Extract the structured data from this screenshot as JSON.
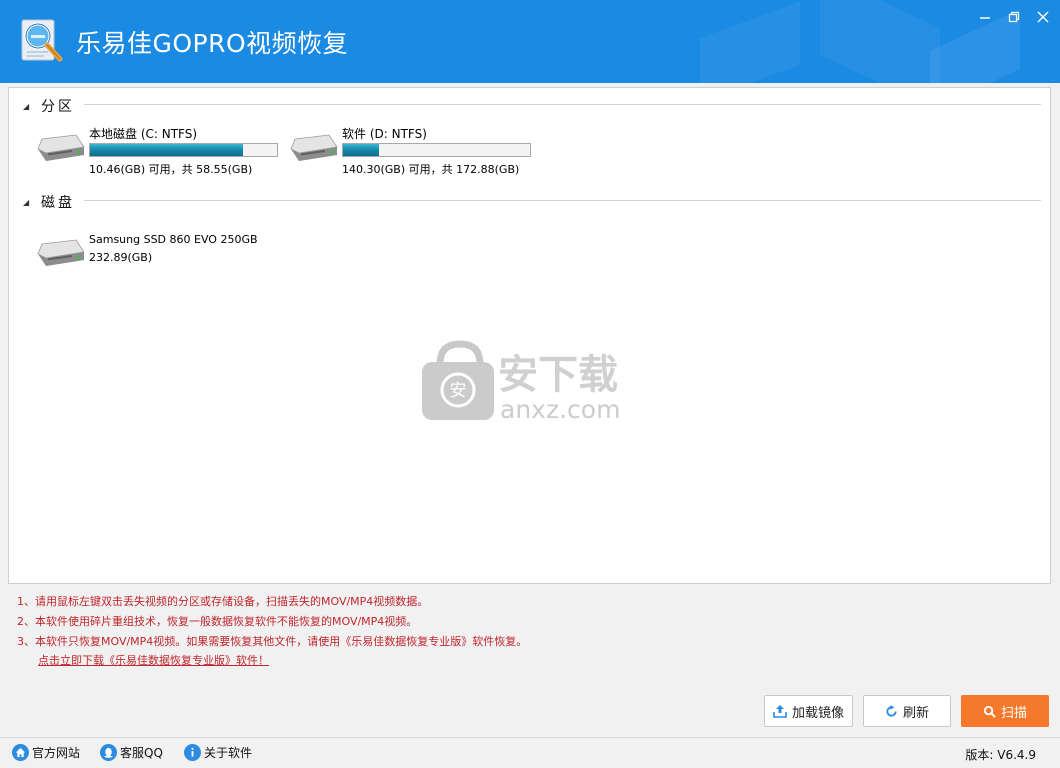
{
  "app": {
    "title": "乐易佳GOPRO视频恢复"
  },
  "groups": {
    "partitions_label": "分区",
    "disks_label": "磁盘"
  },
  "partitions": [
    {
      "name": "本地磁盘 (C: NTFS)",
      "size_text": "10.46(GB) 可用，共 58.55(GB)",
      "used_fraction": 0.82
    },
    {
      "name": "软件 (D: NTFS)",
      "size_text": "140.30(GB) 可用，共 172.88(GB)",
      "used_fraction": 0.19
    }
  ],
  "disks": [
    {
      "name": "Samsung SSD 860 EVO 250GB",
      "size_text": "232.89(GB)"
    }
  ],
  "watermark": {
    "text": "安下载",
    "domain": "anxz.com"
  },
  "notes": [
    "1、请用鼠标左键双击丢失视频的分区或存储设备，扫描丢失的MOV/MP4视频数据。",
    "2、本软件使用碎片重组技术，恢复一般数据恢复软件不能恢复的MOV/MP4视频。",
    "3、本软件只恢复MOV/MP4视频。如果需要恢复其他文件，请使用《乐易佳数据恢复专业版》软件恢复。"
  ],
  "download_link": "点击立即下载《乐易佳数据恢复专业版》软件！",
  "buttons": {
    "load_image": "加载镜像",
    "refresh": "刷新",
    "scan": "扫描"
  },
  "statusbar": {
    "website": "官方网站",
    "support_qq": "客服QQ",
    "about": "关于软件",
    "version": "版本: V6.4.9"
  },
  "colors": {
    "titlebar": "#1b8ae3",
    "scan_button": "#f5782b",
    "notes_text": "#c0262d",
    "progress_fill": "#1787a8"
  }
}
